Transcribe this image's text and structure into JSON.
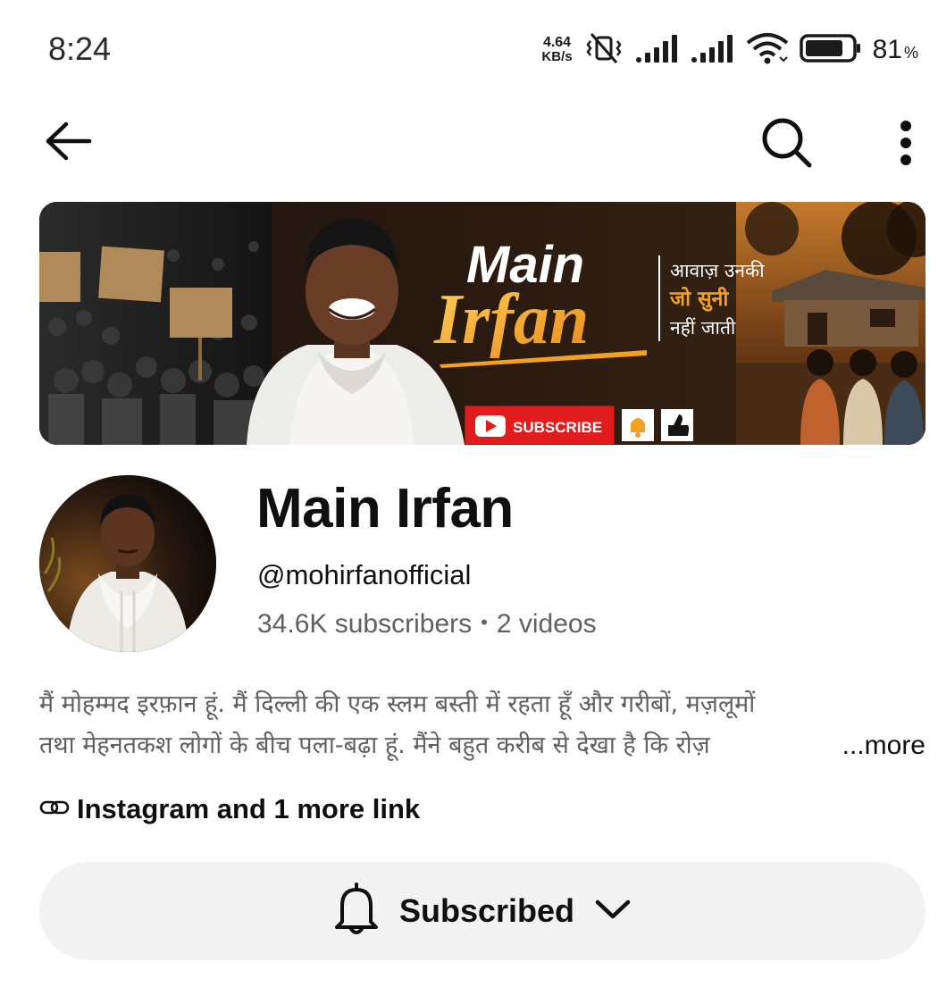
{
  "status_bar": {
    "time": "8:24",
    "net_speed_value": "4.64",
    "net_speed_unit": "KB/s",
    "battery_percent": "81",
    "battery_unit": "%",
    "battery_level": 0.81,
    "icons": [
      "vibrate-off-icon",
      "signal-icon",
      "signal-icon",
      "wifi-icon",
      "battery-icon"
    ]
  },
  "top_bar": {
    "icons": [
      "back-arrow-icon",
      "search-icon",
      "more-vert-icon"
    ]
  },
  "banner": {
    "title_line1": "Main",
    "title_line2": "Irfan",
    "tagline_line1": "आवाज़ उनकी",
    "tagline_line2": "जो सुनी",
    "tagline_line3": "नहीं जाती",
    "subscribe_label": "SUBSCRIBE"
  },
  "channel": {
    "name": "Main Irfan",
    "handle": "@mohirfanofficial",
    "subscribers": "34.6K subscribers",
    "separator": "•",
    "videos": "2 videos"
  },
  "description": {
    "line1": "मैं मोहम्मद इरफ़ान हूं. मैं दिल्ली की एक स्लम बस्ती में रहता हूँ और गरीबों, मज़लूमों",
    "line2": "तथा मेहनतकश लोगों के बीच पला-बढ़ा हूं. मैंने बहुत करीब से देखा है कि रोज़",
    "more_label": "...more"
  },
  "links": {
    "label": "Instagram and 1 more link"
  },
  "subscribe": {
    "label": "Subscribed"
  },
  "colors": {
    "banner_accent_orange": "#f4a021",
    "subscribe_red": "#e21c1c",
    "muted_text": "#606060",
    "button_bg": "#f2f2f2"
  }
}
